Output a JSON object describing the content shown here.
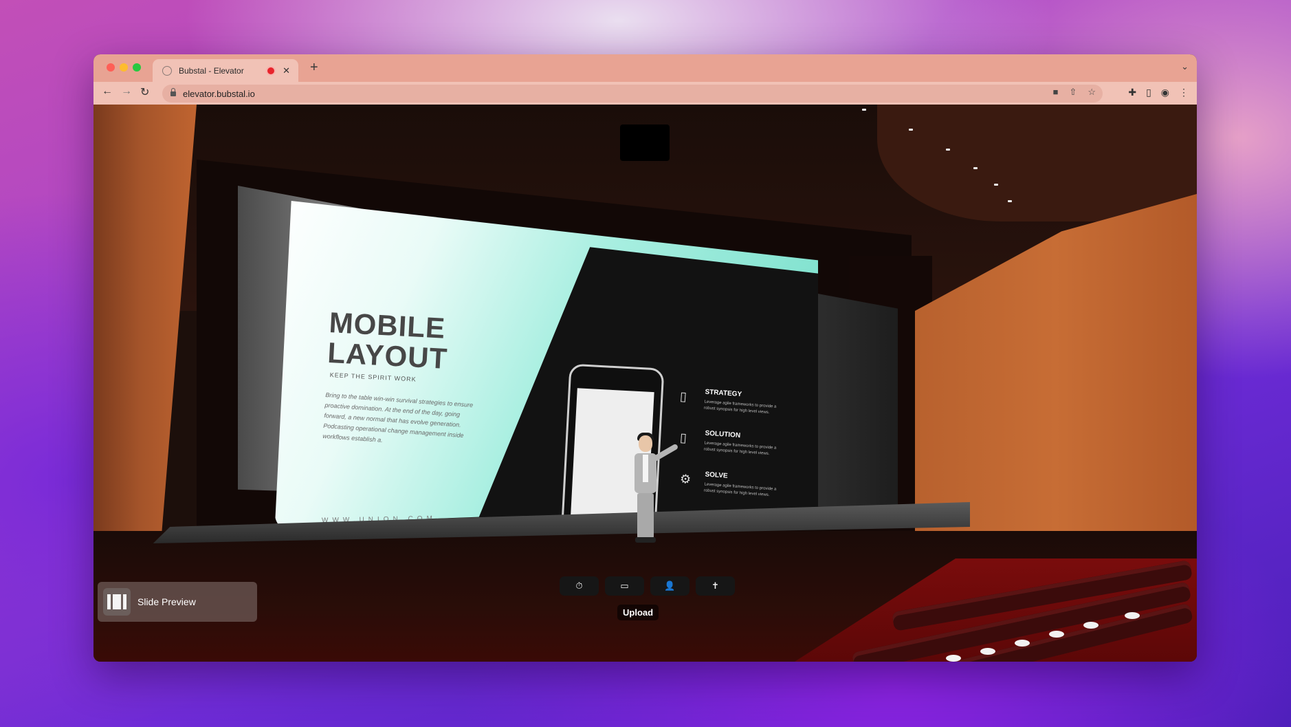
{
  "browser": {
    "tab_title": "Bubstal - Elevator",
    "tab_close": "✕",
    "new_tab": "+",
    "tab_menu": "⌄",
    "url": "elevator.bubstal.io"
  },
  "slide": {
    "title_line1": "MOBILE",
    "title_line2": "LAYOUT",
    "tagline": "KEEP THE SPIRIT WORK",
    "body": "Bring to the table win-win survival strategies to ensure proactive domination. At the end of the day, going forward, a new normal that has evolve generation. Podcasting operational change management inside workflows establish a.",
    "footer_url": "WWW.UNION.COM",
    "features": [
      {
        "title": "STRATEGY",
        "desc": "Leverage agile frameworks to provide a robust synopsis for high level views.",
        "icon": "lock-phone-icon"
      },
      {
        "title": "SOLUTION",
        "desc": "Leverage agile frameworks to provide a robust synopsis for high level views.",
        "icon": "phone-signal-icon"
      },
      {
        "title": "SOLVE",
        "desc": "Leverage agile frameworks to provide a robust synopsis for high level views.",
        "icon": "gear-phone-icon"
      }
    ]
  },
  "controls": {
    "upload_label": "Upload",
    "slide_preview_label": "Slide Preview"
  },
  "colors": {
    "tabbar": "#e8a393",
    "toolbar": "#f1c2b6",
    "slide_accent": "#6fdcc7"
  }
}
